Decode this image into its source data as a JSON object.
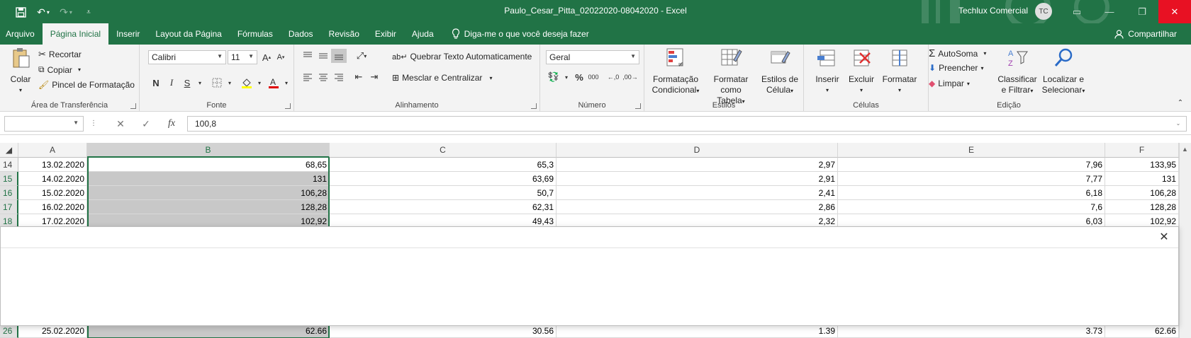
{
  "window": {
    "title": "Paulo_Cesar_Pitta_02022020-08042020  -  Excel",
    "user_name": "Techlux Comercial",
    "user_initials": "TC"
  },
  "tabs": [
    "Arquivo",
    "Página Inicial",
    "Inserir",
    "Layout da Página",
    "Fórmulas",
    "Dados",
    "Revisão",
    "Exibir",
    "Ajuda"
  ],
  "tell_me": "Diga-me o que você deseja fazer",
  "share_label": "Compartilhar",
  "ribbon": {
    "clipboard": {
      "label": "Área de Transferência",
      "paste": "Colar",
      "cut": "Recortar",
      "copy": "Copiar",
      "format_painter": "Pincel de Formatação"
    },
    "font": {
      "label": "Fonte",
      "font_name": "Calibri",
      "font_size": "11",
      "bold": "N",
      "italic": "I",
      "underline": "S"
    },
    "alignment": {
      "label": "Alinhamento",
      "wrap_text": "Quebrar Texto Automaticamente",
      "merge_center": "Mesclar e Centralizar"
    },
    "number": {
      "label": "Número",
      "format": "Geral",
      "percent": "%",
      "thousands": "000"
    },
    "styles": {
      "label": "Estilos",
      "conditional": [
        "Formatação",
        "Condicional"
      ],
      "as_table": [
        "Formatar como",
        "Tabela"
      ],
      "cell_styles": [
        "Estilos de",
        "Célula"
      ]
    },
    "cells": {
      "label": "Células",
      "insert": "Inserir",
      "delete": "Excluir",
      "format": "Formatar"
    },
    "editing": {
      "label": "Edição",
      "autosum": "AutoSoma",
      "fill": "Preencher",
      "clear": "Limpar",
      "sort_filter": [
        "Classificar",
        "e Filtrar"
      ],
      "find_select": [
        "Localizar e",
        "Selecionar"
      ]
    }
  },
  "formula_bar": {
    "name_box": "",
    "fx": "fx",
    "value": "100,8"
  },
  "columns": [
    "A",
    "B",
    "C",
    "D",
    "E",
    "F"
  ],
  "rows": [
    {
      "num": "14",
      "cells": [
        "13.02.2020",
        "68,65",
        "65,3",
        "2,97",
        "7,96",
        "133,95"
      ]
    },
    {
      "num": "15",
      "cells": [
        "14.02.2020",
        "131",
        "63,69",
        "2,91",
        "7,77",
        "131"
      ]
    },
    {
      "num": "16",
      "cells": [
        "15.02.2020",
        "106,28",
        "50,7",
        "2,41",
        "6,18",
        "106,28"
      ]
    },
    {
      "num": "17",
      "cells": [
        "16.02.2020",
        "128,28",
        "62,31",
        "2,86",
        "7,6",
        "128,28"
      ]
    },
    {
      "num": "18",
      "cells": [
        "17.02.2020",
        "102,92",
        "49,43",
        "2,32",
        "6,03",
        "102,92"
      ]
    },
    {
      "num": "26",
      "cells": [
        "25.02.2020",
        "62.66",
        "30.56",
        "1.39",
        "3.73",
        "62.66"
      ]
    }
  ]
}
